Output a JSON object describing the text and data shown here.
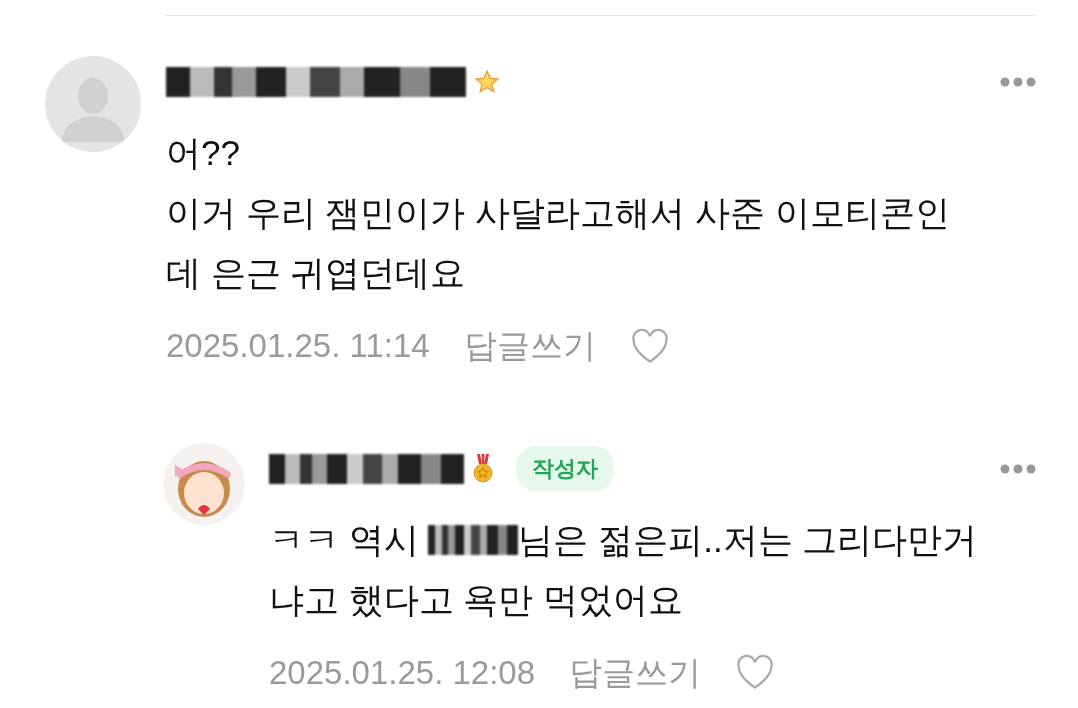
{
  "comments": [
    {
      "kind": "comment",
      "is_writer": false,
      "lines": [
        [
          {
            "text": "어??"
          }
        ],
        [
          {
            "text": "이거 우리 잼민이가 사달라고해서 사준 이모티콘인"
          }
        ],
        [
          {
            "text": "데 은근 귀엽던데요"
          }
        ]
      ],
      "date": "2025.01.25. 11:14",
      "reply_label": "답글쓰기",
      "liked": false
    },
    {
      "kind": "reply",
      "is_writer": true,
      "writer_label": "작성자",
      "lines": [
        [
          {
            "text": "ㅋㅋ 역시 "
          },
          {
            "kind": "redacted"
          },
          {
            "text": "님은 젊은피..저는 그리다만거"
          }
        ],
        [
          {
            "text": "냐고 했다고 욕만 먹었어요"
          }
        ]
      ],
      "date": "2025.01.25. 12:08",
      "reply_label": "답글쓰기",
      "liked": false
    }
  ]
}
